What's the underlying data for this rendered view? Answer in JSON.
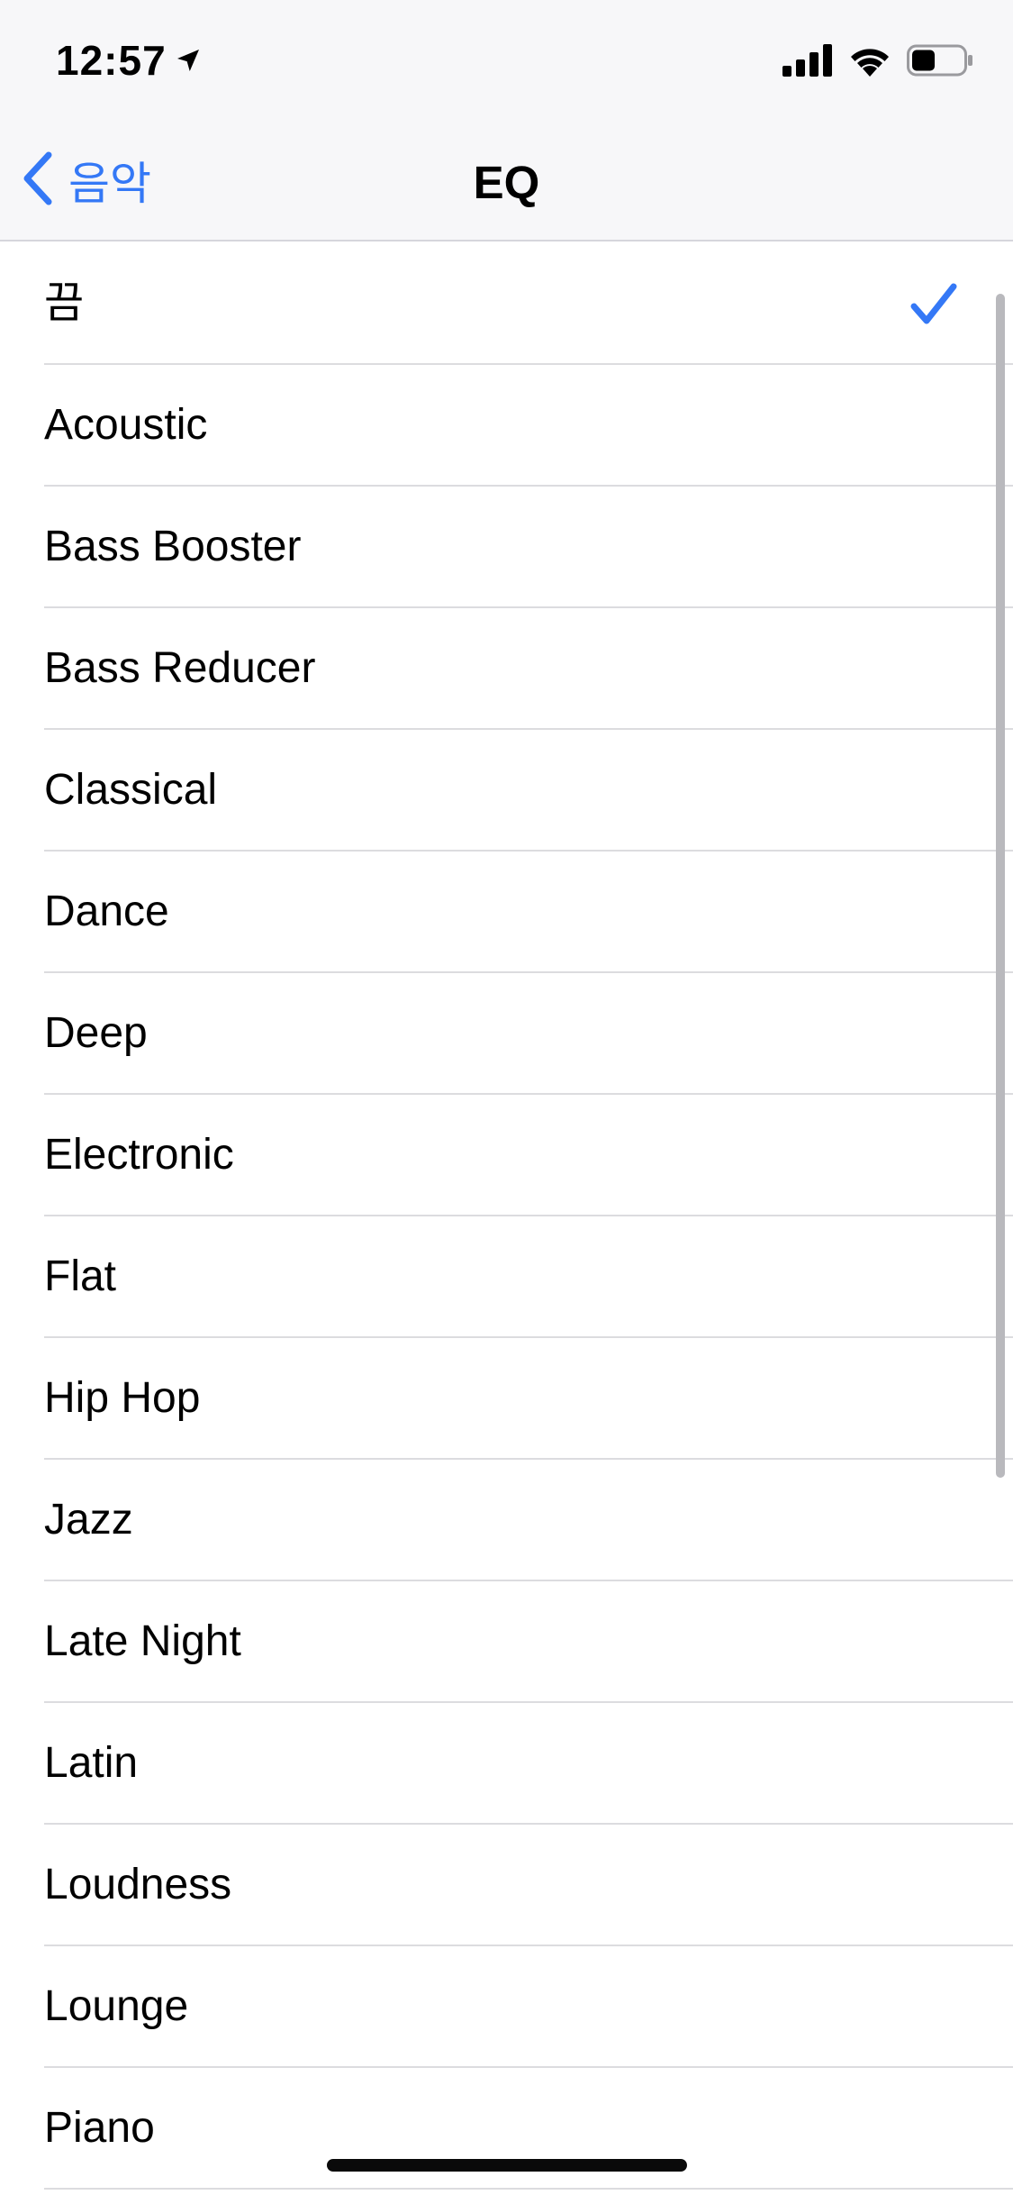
{
  "status_bar": {
    "time": "12:57",
    "location_icon": "location-arrow-icon",
    "signal_icon": "cellular-signal-icon",
    "wifi_icon": "wifi-icon",
    "battery_icon": "battery-icon",
    "battery_level": 0.45
  },
  "nav": {
    "back_label": "음악",
    "back_icon": "chevron-left-icon",
    "title": "EQ"
  },
  "accent_color": "#3478f6",
  "eq_presets": [
    {
      "label": "끔",
      "selected": true
    },
    {
      "label": "Acoustic",
      "selected": false
    },
    {
      "label": "Bass Booster",
      "selected": false
    },
    {
      "label": "Bass Reducer",
      "selected": false
    },
    {
      "label": "Classical",
      "selected": false
    },
    {
      "label": "Dance",
      "selected": false
    },
    {
      "label": "Deep",
      "selected": false
    },
    {
      "label": "Electronic",
      "selected": false
    },
    {
      "label": "Flat",
      "selected": false
    },
    {
      "label": "Hip Hop",
      "selected": false
    },
    {
      "label": "Jazz",
      "selected": false
    },
    {
      "label": "Late Night",
      "selected": false
    },
    {
      "label": "Latin",
      "selected": false
    },
    {
      "label": "Loudness",
      "selected": false
    },
    {
      "label": "Lounge",
      "selected": false
    },
    {
      "label": "Piano",
      "selected": false
    }
  ]
}
